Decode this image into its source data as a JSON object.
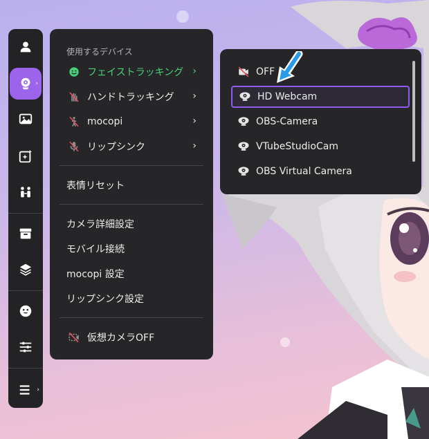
{
  "accent_color": "#9b64ea",
  "active_color": "#49d07a",
  "rail": {
    "items": [
      {
        "name": "user",
        "icon": "user-icon"
      },
      {
        "name": "face-tracking",
        "icon": "webcam-icon",
        "active": true
      },
      {
        "name": "background",
        "icon": "image-icon"
      },
      {
        "name": "effects",
        "icon": "sparkle-frame-icon"
      },
      {
        "name": "collab",
        "icon": "people-icon"
      },
      {
        "name": "store",
        "icon": "store-icon"
      },
      {
        "name": "layers",
        "icon": "layers-icon"
      },
      {
        "name": "expression",
        "icon": "face-icon"
      },
      {
        "name": "settings",
        "icon": "sliders-icon"
      },
      {
        "name": "menu",
        "icon": "hamburger-icon"
      }
    ]
  },
  "menu": {
    "section_label": "使用するデバイス",
    "devices": [
      {
        "label": "フェイストラッキング",
        "icon": "smiley-icon",
        "active": true
      },
      {
        "label": "ハンドトラッキング",
        "icon": "hand-off-icon"
      },
      {
        "label": "mocopi",
        "icon": "mocopi-off-icon"
      },
      {
        "label": "リップシンク",
        "icon": "mic-off-icon"
      }
    ],
    "reset_label": "表情リセット",
    "settings": [
      {
        "label": "カメラ詳細設定"
      },
      {
        "label": "モバイル接続"
      },
      {
        "label": "mocopi 設定"
      },
      {
        "label": "リップシンク設定"
      }
    ],
    "virtual_camera_label": "仮想カメラOFF",
    "virtual_camera_icon": "camera-off-icon"
  },
  "submenu": {
    "items": [
      {
        "label": "OFF",
        "icon": "camera-off-icon"
      },
      {
        "label": "HD Webcam",
        "icon": "webcam-icon",
        "selected": true
      },
      {
        "label": "OBS-Camera",
        "icon": "webcam-icon"
      },
      {
        "label": "VTubeStudioCam",
        "icon": "webcam-icon"
      },
      {
        "label": "OBS Virtual Camera",
        "icon": "webcam-icon"
      }
    ]
  }
}
